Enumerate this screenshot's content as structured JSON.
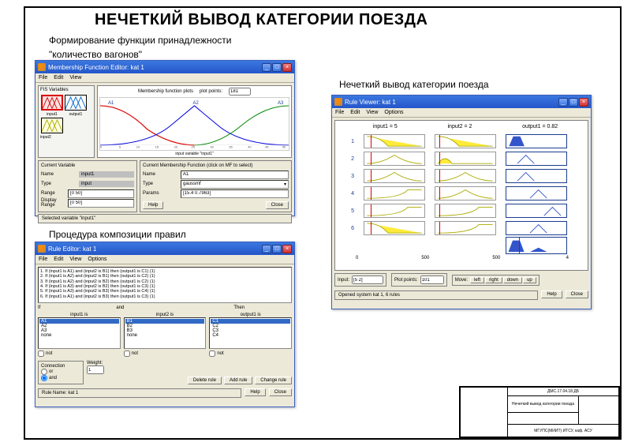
{
  "page": {
    "title": "НЕЧЕТКИЙ ВЫВОД КАТЕГОРИИ ПОЕЗДА",
    "caption1a": "Формирование функции принадлежности",
    "caption1b": "\"количество вагонов\"",
    "caption2": "Процедура композиции правил",
    "caption3": "Нечеткий вывод категории поезда"
  },
  "win1": {
    "title": "Membership Function Editor: kat 1",
    "menu": {
      "file": "File",
      "edit": "Edit",
      "view": "View"
    },
    "fis_label": "FIS Variables",
    "fis": {
      "input1": "input1",
      "output1": "output1",
      "input2": "input2"
    },
    "plot_label": "Membership function plots",
    "plot_points_label": "plot points:",
    "plot_points": "181",
    "mf_names": [
      "A1",
      "A2",
      "A3"
    ],
    "xlabel": "input variable \"input1\"",
    "cv": {
      "title": "Current Variable",
      "name_label": "Name",
      "name": "input1",
      "type_label": "Type",
      "type": "input",
      "range_label": "Range",
      "range": "[0 50]",
      "drange_label": "Display Range",
      "drange": "[0 50]"
    },
    "cmf": {
      "title": "Current Membership Function (click on MF to select)",
      "name_label": "Name",
      "name": "A1",
      "type_label": "Type",
      "type": "gaussmf",
      "params_label": "Params",
      "params": "[15.4 0.7963]"
    },
    "help_btn": "Help",
    "close_btn": "Close",
    "status": "Selected variable \"input1\""
  },
  "win2": {
    "title": "Rule Editor: kat 1",
    "menu": {
      "file": "File",
      "edit": "Edit",
      "view": "View",
      "options": "Options"
    },
    "rules": [
      "1. If (input1 is A1) and (input2 is B1) then (output1 is C1) (1)",
      "2. If (input1 is A2) and (input2 is B1) then (output1 is C2) (1)",
      "3. If (input1 is A2) and (input2 is B2) then (output1 is C2) (1)",
      "4. If (input1 is A3) and (input2 is B2) then (output1 is C3) (1)",
      "5. If (input1 is A3) and (input2 is B3) then (output1 is C4) (1)",
      "6. If (input1 is A1) and (input2 is B3) then (output1 is C3) (1)"
    ],
    "if_label": "If",
    "and_label": "and",
    "then_label": "Then",
    "col1": {
      "label": "input1 is",
      "opts": [
        "A1",
        "A2",
        "A3",
        "none"
      ],
      "sel": 0
    },
    "col2": {
      "label": "input2 is",
      "opts": [
        "B1",
        "B2",
        "B3",
        "none"
      ],
      "sel": 0
    },
    "col3": {
      "label": "output1 is",
      "opts": [
        "C1",
        "C2",
        "C3",
        "C4",
        "none"
      ],
      "sel": 0
    },
    "not_label": "not",
    "conn": {
      "title": "Connection",
      "or": "or",
      "and": "and"
    },
    "weight": {
      "label": "Weight:",
      "value": "1"
    },
    "btns": {
      "del": "Delete rule",
      "add": "Add rule",
      "chg": "Change rule"
    },
    "status": "Rule Name: kat 1",
    "help_btn": "Help",
    "close_btn": "Close"
  },
  "win3": {
    "title": "Rule Viewer: kat 1",
    "menu": {
      "file": "File",
      "edit": "Edit",
      "view": "View",
      "options": "Options"
    },
    "hdr": {
      "i1": "input1 = 5",
      "i2": "input2 = 2",
      "o1": "output1 = 0.82"
    },
    "rownums": [
      "1",
      "2",
      "3",
      "4",
      "5",
      "6"
    ],
    "ruler": {
      "i_lo": "0",
      "i_hi": "50",
      "o_lo": "0",
      "o_hi": "4"
    },
    "input_label": "Input:",
    "input_val": "[5 2]",
    "pp_label": "Plot points:",
    "pp_val": "101",
    "move_label": "Move:",
    "move": {
      "left": "left",
      "right": "right",
      "down": "down",
      "up": "up"
    },
    "status": "Opened system kat 1, 6 rules",
    "help_btn": "Help",
    "close_btn": "Close"
  },
  "title_block": {
    "code": "ДМС.17.04.18.ДБ",
    "desc": "Нечеткий вывод категории поезда",
    "org": "МГУПС(МИИТ) ИТСУ, каф. АСУ"
  },
  "chart_data": {
    "type": "line",
    "title": "Membership function plots",
    "xlabel": "input variable \"input1\"",
    "ylabel": "",
    "xlim": [
      0,
      50
    ],
    "ylim": [
      0,
      1
    ],
    "x_ticks": [
      0,
      5,
      10,
      15,
      20,
      25,
      30,
      35,
      40,
      45,
      50
    ],
    "series": [
      {
        "name": "A1",
        "type": "gaussmf",
        "params": [
          15.4,
          0.8
        ],
        "color": "#ff0000"
      },
      {
        "name": "A2",
        "type": "gaussmf",
        "params": [
          15.4,
          25
        ],
        "color": "#0000ff"
      },
      {
        "name": "A3",
        "type": "gaussmf",
        "params": [
          15.4,
          50
        ],
        "color": "#008000"
      }
    ]
  }
}
